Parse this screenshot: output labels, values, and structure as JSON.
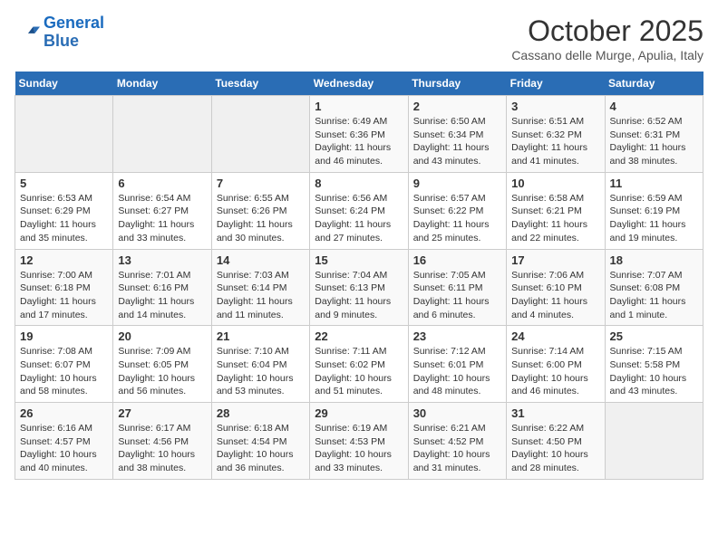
{
  "header": {
    "logo_line1": "General",
    "logo_line2": "Blue",
    "month": "October 2025",
    "location": "Cassano delle Murge, Apulia, Italy"
  },
  "days_of_week": [
    "Sunday",
    "Monday",
    "Tuesday",
    "Wednesday",
    "Thursday",
    "Friday",
    "Saturday"
  ],
  "weeks": [
    [
      {
        "day": "",
        "text": ""
      },
      {
        "day": "",
        "text": ""
      },
      {
        "day": "",
        "text": ""
      },
      {
        "day": "1",
        "text": "Sunrise: 6:49 AM\nSunset: 6:36 PM\nDaylight: 11 hours and 46 minutes."
      },
      {
        "day": "2",
        "text": "Sunrise: 6:50 AM\nSunset: 6:34 PM\nDaylight: 11 hours and 43 minutes."
      },
      {
        "day": "3",
        "text": "Sunrise: 6:51 AM\nSunset: 6:32 PM\nDaylight: 11 hours and 41 minutes."
      },
      {
        "day": "4",
        "text": "Sunrise: 6:52 AM\nSunset: 6:31 PM\nDaylight: 11 hours and 38 minutes."
      }
    ],
    [
      {
        "day": "5",
        "text": "Sunrise: 6:53 AM\nSunset: 6:29 PM\nDaylight: 11 hours and 35 minutes."
      },
      {
        "day": "6",
        "text": "Sunrise: 6:54 AM\nSunset: 6:27 PM\nDaylight: 11 hours and 33 minutes."
      },
      {
        "day": "7",
        "text": "Sunrise: 6:55 AM\nSunset: 6:26 PM\nDaylight: 11 hours and 30 minutes."
      },
      {
        "day": "8",
        "text": "Sunrise: 6:56 AM\nSunset: 6:24 PM\nDaylight: 11 hours and 27 minutes."
      },
      {
        "day": "9",
        "text": "Sunrise: 6:57 AM\nSunset: 6:22 PM\nDaylight: 11 hours and 25 minutes."
      },
      {
        "day": "10",
        "text": "Sunrise: 6:58 AM\nSunset: 6:21 PM\nDaylight: 11 hours and 22 minutes."
      },
      {
        "day": "11",
        "text": "Sunrise: 6:59 AM\nSunset: 6:19 PM\nDaylight: 11 hours and 19 minutes."
      }
    ],
    [
      {
        "day": "12",
        "text": "Sunrise: 7:00 AM\nSunset: 6:18 PM\nDaylight: 11 hours and 17 minutes."
      },
      {
        "day": "13",
        "text": "Sunrise: 7:01 AM\nSunset: 6:16 PM\nDaylight: 11 hours and 14 minutes."
      },
      {
        "day": "14",
        "text": "Sunrise: 7:03 AM\nSunset: 6:14 PM\nDaylight: 11 hours and 11 minutes."
      },
      {
        "day": "15",
        "text": "Sunrise: 7:04 AM\nSunset: 6:13 PM\nDaylight: 11 hours and 9 minutes."
      },
      {
        "day": "16",
        "text": "Sunrise: 7:05 AM\nSunset: 6:11 PM\nDaylight: 11 hours and 6 minutes."
      },
      {
        "day": "17",
        "text": "Sunrise: 7:06 AM\nSunset: 6:10 PM\nDaylight: 11 hours and 4 minutes."
      },
      {
        "day": "18",
        "text": "Sunrise: 7:07 AM\nSunset: 6:08 PM\nDaylight: 11 hours and 1 minute."
      }
    ],
    [
      {
        "day": "19",
        "text": "Sunrise: 7:08 AM\nSunset: 6:07 PM\nDaylight: 10 hours and 58 minutes."
      },
      {
        "day": "20",
        "text": "Sunrise: 7:09 AM\nSunset: 6:05 PM\nDaylight: 10 hours and 56 minutes."
      },
      {
        "day": "21",
        "text": "Sunrise: 7:10 AM\nSunset: 6:04 PM\nDaylight: 10 hours and 53 minutes."
      },
      {
        "day": "22",
        "text": "Sunrise: 7:11 AM\nSunset: 6:02 PM\nDaylight: 10 hours and 51 minutes."
      },
      {
        "day": "23",
        "text": "Sunrise: 7:12 AM\nSunset: 6:01 PM\nDaylight: 10 hours and 48 minutes."
      },
      {
        "day": "24",
        "text": "Sunrise: 7:14 AM\nSunset: 6:00 PM\nDaylight: 10 hours and 46 minutes."
      },
      {
        "day": "25",
        "text": "Sunrise: 7:15 AM\nSunset: 5:58 PM\nDaylight: 10 hours and 43 minutes."
      }
    ],
    [
      {
        "day": "26",
        "text": "Sunrise: 6:16 AM\nSunset: 4:57 PM\nDaylight: 10 hours and 40 minutes."
      },
      {
        "day": "27",
        "text": "Sunrise: 6:17 AM\nSunset: 4:56 PM\nDaylight: 10 hours and 38 minutes."
      },
      {
        "day": "28",
        "text": "Sunrise: 6:18 AM\nSunset: 4:54 PM\nDaylight: 10 hours and 36 minutes."
      },
      {
        "day": "29",
        "text": "Sunrise: 6:19 AM\nSunset: 4:53 PM\nDaylight: 10 hours and 33 minutes."
      },
      {
        "day": "30",
        "text": "Sunrise: 6:21 AM\nSunset: 4:52 PM\nDaylight: 10 hours and 31 minutes."
      },
      {
        "day": "31",
        "text": "Sunrise: 6:22 AM\nSunset: 4:50 PM\nDaylight: 10 hours and 28 minutes."
      },
      {
        "day": "",
        "text": ""
      }
    ]
  ]
}
